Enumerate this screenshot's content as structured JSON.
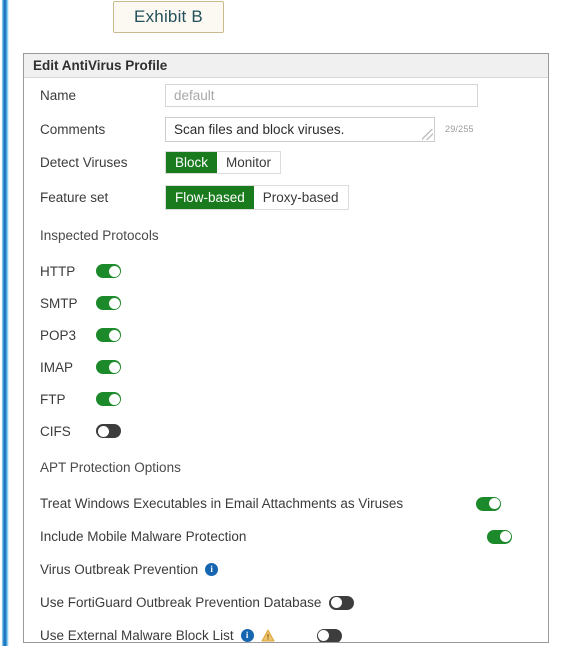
{
  "exhibit": {
    "label": "Exhibit B"
  },
  "panel": {
    "title": "Edit AntiVirus Profile",
    "fields": {
      "name": {
        "label": "Name",
        "value": "",
        "placeholder": "default"
      },
      "comments": {
        "label": "Comments",
        "value": "Scan files and block viruses.",
        "counter": "29/255",
        "resize_handle": "resize-grip-icon"
      },
      "detect_viruses": {
        "label": "Detect Viruses",
        "options": [
          "Block",
          "Monitor"
        ],
        "selected": "Block"
      },
      "feature_set": {
        "label": "Feature set",
        "options": [
          "Flow-based",
          "Proxy-based"
        ],
        "selected": "Flow-based"
      }
    },
    "inspected_protocols": {
      "heading": "Inspected Protocols",
      "items": [
        {
          "label": "HTTP",
          "state": "on"
        },
        {
          "label": "SMTP",
          "state": "on"
        },
        {
          "label": "POP3",
          "state": "on"
        },
        {
          "label": "IMAP",
          "state": "on"
        },
        {
          "label": "FTP",
          "state": "on"
        },
        {
          "label": "CIFS",
          "state": "off"
        }
      ]
    },
    "apt_protection": {
      "heading": "APT Protection Options",
      "items": [
        {
          "label": "Treat Windows Executables in Email Attachments as Viruses",
          "state": "on"
        },
        {
          "label": "Include Mobile Malware Protection",
          "state": "on"
        },
        {
          "label": "Virus Outbreak Prevention",
          "state": "none",
          "info_icon": "info-icon"
        },
        {
          "label": "Use FortiGuard Outbreak Prevention Database",
          "state": "off"
        },
        {
          "label": "Use External Malware Block List",
          "state": "off",
          "info_icon": "info-icon",
          "warning_icon": "warning-triangle-icon"
        }
      ]
    }
  },
  "colors": {
    "accent_green": "#1a7a1e",
    "toggle_on": "#1c8a2a",
    "toggle_off": "#3d3d3d",
    "info_blue": "#1565b0",
    "warning_amber": "#eab24a",
    "rail_blue": "#1f74c0",
    "exhibit_border": "#c9bb8e",
    "exhibit_text": "#24505c"
  }
}
